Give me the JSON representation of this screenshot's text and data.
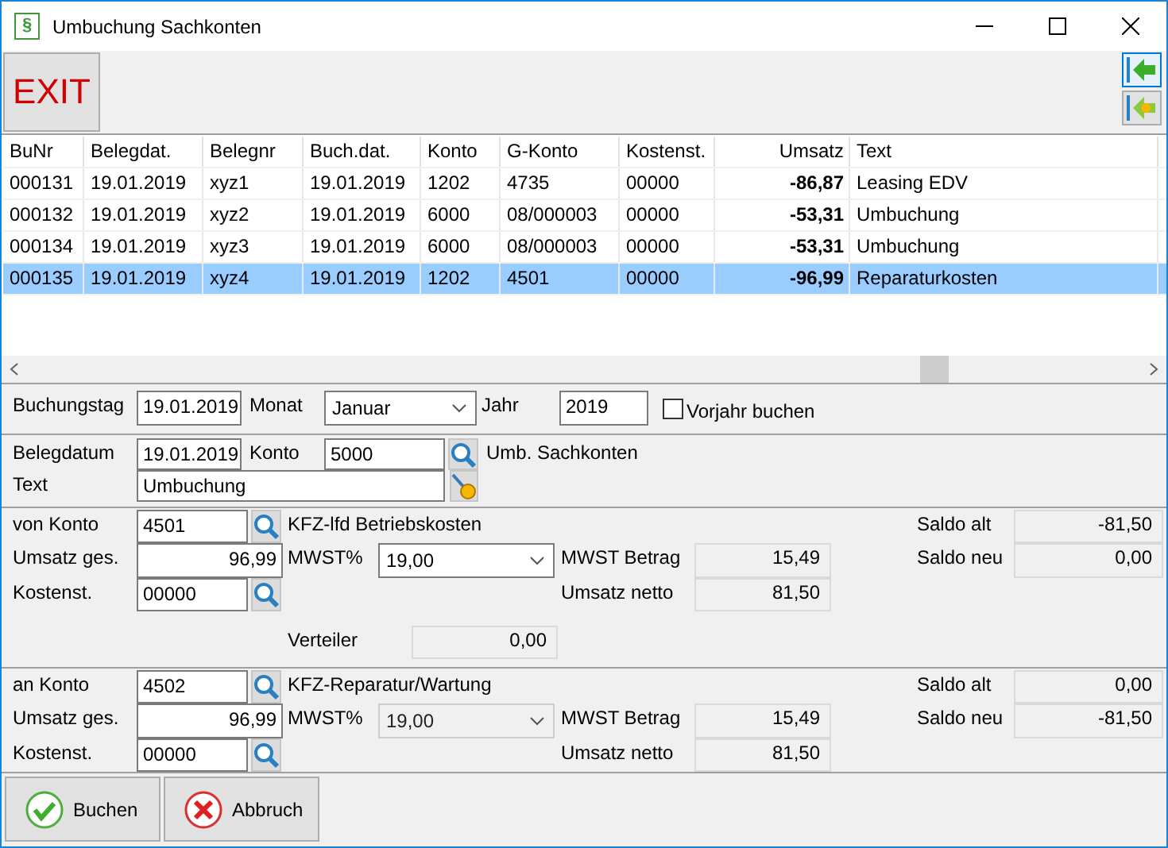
{
  "window": {
    "title": "Umbuchung Sachkonten",
    "icon_glyph": "§"
  },
  "toolbar": {
    "exit_label": "EXIT"
  },
  "table": {
    "columns": [
      {
        "label": "BuNr",
        "kind": "text"
      },
      {
        "label": "Belegdat.",
        "kind": "text"
      },
      {
        "label": "Belegnr",
        "kind": "text"
      },
      {
        "label": "Buch.dat.",
        "kind": "text"
      },
      {
        "label": "Konto",
        "kind": "text"
      },
      {
        "label": "G-Konto",
        "kind": "text"
      },
      {
        "label": "Kostenst.",
        "kind": "text"
      },
      {
        "label": "Umsatz",
        "kind": "amount"
      },
      {
        "label": "Text",
        "kind": "text"
      }
    ],
    "rows": [
      {
        "cells": [
          "000131",
          "19.01.2019",
          "xyz1",
          "19.01.2019",
          "1202",
          "4735",
          "00000",
          "-86,87",
          "Leasing EDV"
        ],
        "selected": false
      },
      {
        "cells": [
          "000132",
          "19.01.2019",
          "xyz2",
          "19.01.2019",
          "6000",
          "08/000003",
          "00000",
          "-53,31",
          "Umbuchung"
        ],
        "selected": false
      },
      {
        "cells": [
          "000134",
          "19.01.2019",
          "xyz3",
          "19.01.2019",
          "6000",
          "08/000003",
          "00000",
          "-53,31",
          "Umbuchung"
        ],
        "selected": false
      },
      {
        "cells": [
          "000135",
          "19.01.2019",
          "xyz4",
          "19.01.2019",
          "1202",
          "4501",
          "00000",
          "-96,99",
          "Reparaturkosten"
        ],
        "selected": true
      }
    ]
  },
  "booking": {
    "buchungstag": {
      "label": "Buchungstag",
      "value": "19.01.2019"
    },
    "monat": {
      "label": "Monat",
      "value": "Januar"
    },
    "jahr": {
      "label": "Jahr",
      "value": "2019"
    },
    "vorjahr": {
      "label": "Vorjahr buchen",
      "checked": false
    }
  },
  "document": {
    "belegdatum": {
      "label": "Belegdatum",
      "value": "19.01.2019"
    },
    "konto": {
      "label": "Konto",
      "value": "5000",
      "name": "Umb. Sachkonten"
    },
    "text": {
      "label": "Text",
      "value": "Umbuchung"
    }
  },
  "from_account": {
    "konto_label": "von Konto",
    "konto": "4501",
    "name": "KFZ-lfd Betriebskosten",
    "umsatz_label": "Umsatz ges.",
    "umsatz": "96,99",
    "mwst_label": "MWST%",
    "mwst": "19,00",
    "mwst_disabled": false,
    "kostenst_label": "Kostenst.",
    "kostenst": "00000",
    "mwst_betrag_label": "MWST Betrag",
    "mwst_betrag": "15,49",
    "netto_label": "Umsatz netto",
    "netto": "81,50",
    "saldo_alt_label": "Saldo alt",
    "saldo_alt": "-81,50",
    "saldo_neu_label": "Saldo neu",
    "saldo_neu": "0,00"
  },
  "distributor": {
    "label": "Verteiler",
    "value": "0,00"
  },
  "to_account": {
    "konto_label": "an Konto",
    "konto": "4502",
    "name": "KFZ-Reparatur/Wartung",
    "umsatz_label": "Umsatz ges.",
    "umsatz": "96,99",
    "mwst_label": "MWST%",
    "mwst": "19,00",
    "mwst_disabled": true,
    "kostenst_label": "Kostenst.",
    "kostenst": "00000",
    "mwst_betrag_label": "MWST Betrag",
    "mwst_betrag": "15,49",
    "netto_label": "Umsatz netto",
    "netto": "81,50",
    "saldo_alt_label": "Saldo alt",
    "saldo_alt": "0,00",
    "saldo_neu_label": "Saldo neu",
    "saldo_neu": "-81,50"
  },
  "buttons": [
    {
      "label": "Buchen",
      "kind": "ok"
    },
    {
      "label": "Abbruch",
      "kind": "cancel"
    }
  ]
}
